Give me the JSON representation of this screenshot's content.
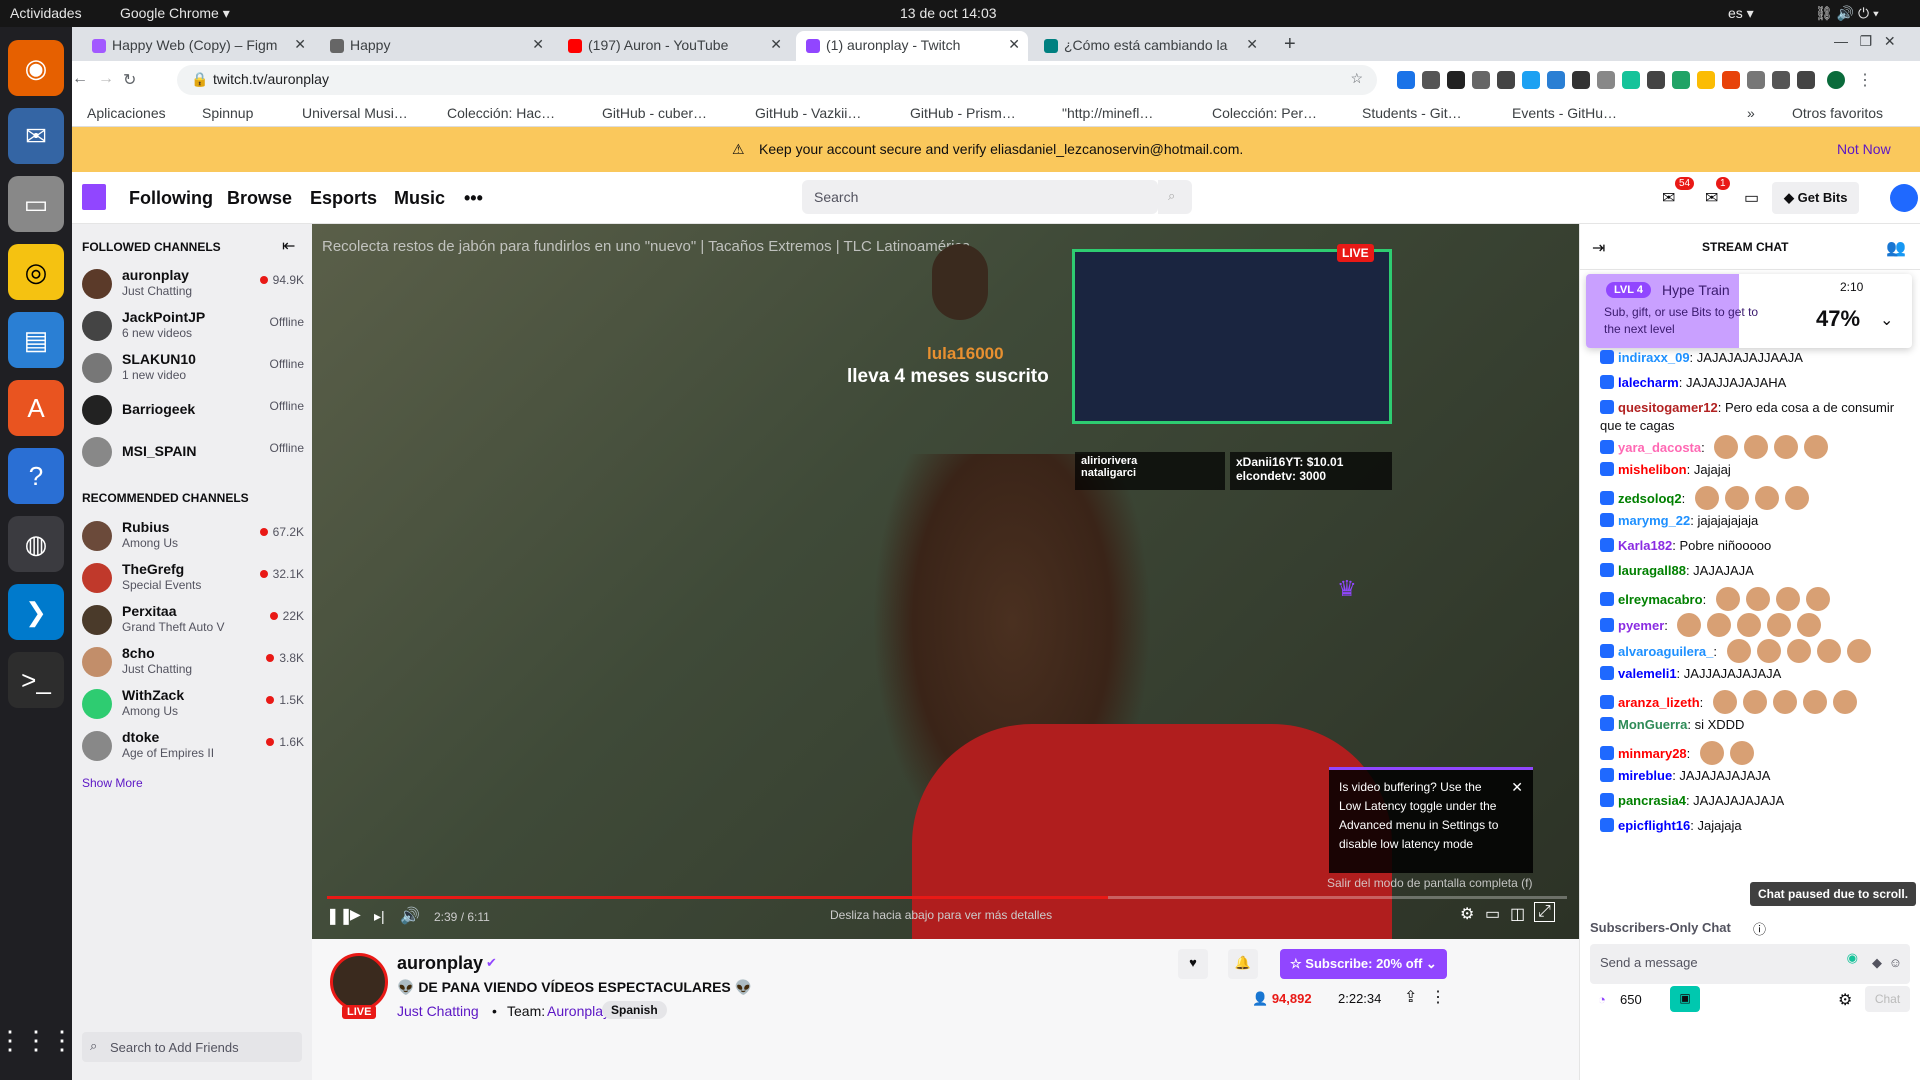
{
  "os": {
    "activities": "Actividades",
    "app": "Google Chrome ▾",
    "clock": "13 de oct  14:03",
    "lang": "es ▾"
  },
  "tabs": [
    {
      "label": "Happy Web (Copy) – Figm",
      "color": "#a259ff"
    },
    {
      "label": "Happy",
      "color": "#555"
    },
    {
      "label": "(197) Auron - YouTube",
      "color": "#ff0000"
    },
    {
      "label": "(1) auronplay - Twitch",
      "color": "#9146ff"
    },
    {
      "label": "¿Cómo está cambiando la",
      "color": "#008080"
    }
  ],
  "url": "twitch.tv/auronplay",
  "bookmarks": [
    "Aplicaciones",
    "Spinnup",
    "Universal Musi…",
    "Colección: Hac…",
    "GitHub - cuber…",
    "GitHub - Vazkii…",
    "GitHub - Prism…",
    "\"http://minefl…",
    "Colección: Per…",
    "Students - Git…",
    "Events - GitHu…",
    "»",
    "Otros favoritos"
  ],
  "banner": {
    "text": "Keep your account secure and verify eliasdaniel_lezcanoservin@hotmail.com.",
    "action": "Not Now"
  },
  "nav": {
    "links": [
      "Following",
      "Browse",
      "Esports",
      "Music",
      "•••"
    ],
    "search_placeholder": "Search",
    "notif_count": "54",
    "inbox_count": "1",
    "get_bits": "Get Bits"
  },
  "sidebar": {
    "followed_title": "FOLLOWED CHANNELS",
    "followed": [
      {
        "name": "auronplay",
        "sub": "Just Chatting",
        "status": "94.9K",
        "live": true,
        "color": "#5b3a29"
      },
      {
        "name": "JackPointJP",
        "sub": "6 new videos",
        "status": "Offline",
        "live": false,
        "color": "#444"
      },
      {
        "name": "SLAKUN10",
        "sub": "1 new video",
        "status": "Offline",
        "live": false,
        "color": "#777"
      },
      {
        "name": "Barriogeek",
        "sub": "",
        "status": "Offline",
        "live": false,
        "color": "#222"
      },
      {
        "name": "MSI_SPAIN",
        "sub": "",
        "status": "Offline",
        "live": false,
        "color": "#888"
      }
    ],
    "recommended_title": "RECOMMENDED CHANNELS",
    "recommended": [
      {
        "name": "Rubius",
        "sub": "Among Us",
        "status": "67.2K",
        "color": "#6b4a3a"
      },
      {
        "name": "TheGrefg",
        "sub": "Special Events",
        "status": "32.1K",
        "color": "#c0392b"
      },
      {
        "name": "Perxitaa",
        "sub": "Grand Theft Auto V",
        "status": "22K",
        "color": "#4a3a2a"
      },
      {
        "name": "8cho",
        "sub": "Just Chatting",
        "status": "3.8K",
        "color": "#c28e6a"
      },
      {
        "name": "WithZack",
        "sub": "Among Us",
        "status": "1.5K",
        "color": "#2ecc71"
      },
      {
        "name": "dtoke",
        "sub": "Age of Empires II",
        "status": "1.6K",
        "color": "#888"
      }
    ],
    "show_more": "Show More",
    "friends_placeholder": "Search to Add Friends"
  },
  "video": {
    "overlay_title": "Recolecta restos de jabón para fundirlos en uno \"nuevo\" | Tacaños Extremos | TLC Latinoamérica",
    "sub_user": "lula16000",
    "sub_text": "lleva 4 meses suscrito",
    "live": "LIVE",
    "cam_names": [
      "alirioriverа",
      "nataligarci"
    ],
    "cam_donations": [
      "xDanii16YT: $10.01",
      "elcondetv: 3000"
    ],
    "time": "2:39 / 6:11",
    "swipe_hint": "Desliza hacia abajo para ver más detalles",
    "tooltip": "Is video buffering? Use the Low Latency toggle under the Advanced menu in Settings to disable low latency mode",
    "fullscreen_hint": "Salir del modo de pantalla completa (f)",
    "progress": 0.63
  },
  "stream": {
    "channel": "auronplay",
    "title": "👽 DE PANA VIENDO VÍDEOS ESPECTACULARES 👽",
    "category": "Just Chatting",
    "team_label": "Team:",
    "team": "Auronplay",
    "tag": "Spanish",
    "viewers": "94,892",
    "uptime": "2:22:34",
    "subscribe": "Subscribe: 20% off",
    "live": "LIVE"
  },
  "chat": {
    "title": "STREAM CHAT",
    "hype": {
      "level": "LVL 4",
      "label": "Hype Train",
      "timer": "2:10",
      "desc": "Sub, gift, or use Bits to get to the next level",
      "percent": "47%"
    },
    "messages": [
      {
        "user": "indiraxx_09",
        "text": "JAJAJAJAJJAAJA",
        "color": "#1e90ff",
        "emotes": 0
      },
      {
        "user": "lalecharm",
        "text": "JAJAJJAJAJAHA",
        "color": "#0000ff",
        "emotes": 0
      },
      {
        "user": "quesitogamer12",
        "text": "Pero eda cosa a de consumir que te cagas",
        "color": "#b22222",
        "emotes": 0
      },
      {
        "user": "yara_dacosta",
        "text": "",
        "color": "#ff69b4",
        "emotes": 4
      },
      {
        "user": "mishelibon",
        "text": "Jajajaj",
        "color": "#ff0000",
        "emotes": 0
      },
      {
        "user": "zedsoloq2",
        "text": "",
        "color": "#008000",
        "emotes": 4
      },
      {
        "user": "marymg_22",
        "text": "jajajajajaja",
        "color": "#1e90ff",
        "emotes": 0
      },
      {
        "user": "Karla182",
        "text": "Pobre niñooooo",
        "color": "#8a2be2",
        "emotes": 0
      },
      {
        "user": "lauragall88",
        "text": "JAJAJAJA",
        "color": "#008000",
        "emotes": 0
      },
      {
        "user": "elreymacabro",
        "text": "",
        "color": "#008000",
        "emotes": 4
      },
      {
        "user": "pyemer",
        "text": "",
        "color": "#8a2be2",
        "emotes": 5
      },
      {
        "user": "alvaroaguilera_",
        "text": "",
        "color": "#1e90ff",
        "emotes": 5
      },
      {
        "user": "valemeli1",
        "text": "JAJJAJAJAJAJA",
        "color": "#0000ff",
        "emotes": 0
      },
      {
        "user": "aranza_lizeth",
        "text": "",
        "color": "#ff0000",
        "emotes": 5
      },
      {
        "user": "MonGuerra",
        "text": "si XDDD",
        "color": "#2e8b57",
        "emotes": 0
      },
      {
        "user": "minmary28",
        "text": "",
        "color": "#ff0000",
        "emotes": 2
      },
      {
        "user": "mireblue",
        "text": "JAJAJAJAJAJA",
        "color": "#0000ff",
        "emotes": 0
      },
      {
        "user": "pancrasia4",
        "text": "JAJAJAJAJAJA",
        "color": "#008000",
        "emotes": 0
      },
      {
        "user": "epicflight16",
        "text": "Jajajaja",
        "color": "#0000ff",
        "emotes": 0
      }
    ],
    "paused": "Chat paused due to scroll.",
    "subs_only": "Subscribers-Only Chat",
    "placeholder": "Send a message",
    "points": "650",
    "chat_button": "Chat"
  }
}
